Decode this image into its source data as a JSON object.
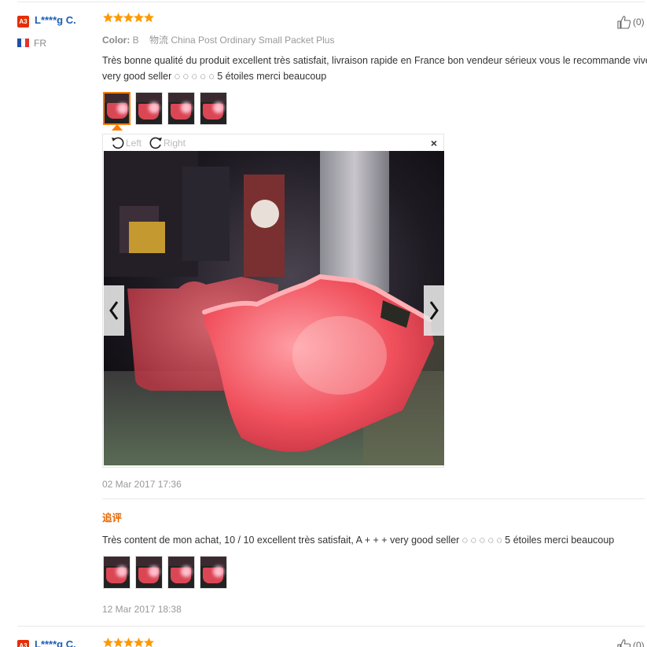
{
  "review1": {
    "level": "A3",
    "user": "L****g C.",
    "country": "FR",
    "rating": 5,
    "likes": "(0)",
    "color_label": "Color:",
    "color_value": "B",
    "shipping": "物流 China Post Ordinary Small Packet Plus",
    "text_line1": "Très bonne qualité du produit excellent très satisfait, livraison rapide en France bon vendeur sérieux vous le recommande vivement.",
    "text_line2": "very good seller ◌ ◌ ◌ ◌ ◌ 5 étoiles merci beaucoup",
    "thumb_count": 4,
    "viewer": {
      "rotate_left": "Left",
      "rotate_right": "Right",
      "close": "×"
    },
    "date": "02 Mar 2017 17:36",
    "followup_label": "追评",
    "followup_text": "Très content de mon achat, 10 / 10 excellent très satisfait, A + + + very good seller ◌ ◌ ◌ ◌ ◌ 5 étoiles merci beaucoup",
    "followup_date": "12 Mar 2017 18:38"
  },
  "review2": {
    "level": "A3",
    "user": "L****g C.",
    "rating": 5,
    "likes": "(0)"
  },
  "colors": {
    "accent_orange": "#ff7a00",
    "star": "#ff9900",
    "badge_red": "#e62e04",
    "link_blue": "#1a5fb4"
  },
  "icons": [
    "thumbs-up-icon",
    "star-icon",
    "rotate-left-icon",
    "rotate-right-icon",
    "close-icon",
    "chevron-left-icon",
    "chevron-right-icon",
    "france-flag-icon"
  ]
}
